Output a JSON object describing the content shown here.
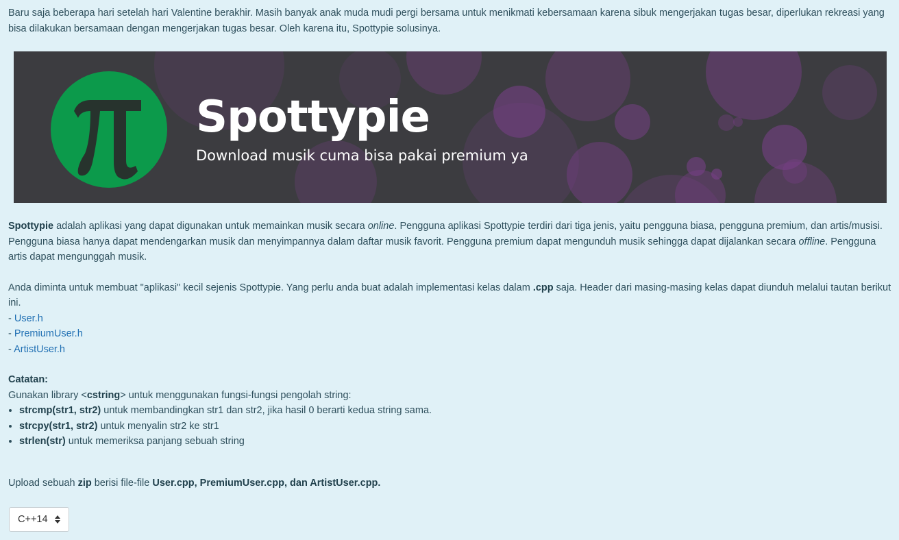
{
  "intro": "Baru saja beberapa hari setelah hari Valentine berakhir. Masih banyak anak muda mudi pergi bersama untuk menikmati kebersamaan karena sibuk mengerjakan tugas besar, diperlukan rekreasi yang bisa dilakukan bersamaan dengan mengerjakan tugas besar. Oleh karena itu, Spottypie solusinya.",
  "banner": {
    "logo_glyph": "π",
    "title": "Spottypie",
    "subtitle": "Download musik cuma bisa pakai premium ya",
    "colors": {
      "background": "#3c3c40",
      "logo": "#0c9a4b",
      "bubble": "#7a3f8a"
    }
  },
  "description": {
    "app_name": "Spottypie",
    "part1": " adalah aplikasi yang dapat digunakan untuk memainkan musik secara ",
    "online": "online",
    "part2": ". Pengguna aplikasi Spottypie terdiri dari tiga jenis, yaitu pengguna biasa, pengguna premium, dan artis/musisi. Pengguna biasa hanya dapat mendengarkan musik dan menyimpannya dalam daftar musik favorit. Pengguna premium dapat mengunduh musik sehingga dapat dijalankan secara ",
    "offline": "offline",
    "part3": ". Pengguna artis dapat mengunggah musik."
  },
  "task": {
    "part1": "Anda diminta untuk membuat \"aplikasi\" kecil sejenis Spottypie. Yang perlu anda buat adalah implementasi kelas dalam ",
    "ext": ".cpp",
    "part2": " saja. Header dari masing-masing kelas dapat diunduh melalui tautan berikut ini.",
    "link_prefix": "- ",
    "links": [
      "User.h",
      "PremiumUser.h",
      "ArtistUser.h"
    ]
  },
  "note": {
    "heading": "Catatan:",
    "part1": "Gunakan library <",
    "lib": "cstring",
    "part2": "> untuk menggunakan fungsi-fungsi pengolah string:",
    "items": [
      {
        "fn": "strcmp(str1, str2)",
        "desc": " untuk membandingkan str1 dan str2, jika hasil 0 berarti kedua string sama."
      },
      {
        "fn": "strcpy(str1, str2)",
        "desc": " untuk menyalin str2 ke str1"
      },
      {
        "fn": "strlen(str)",
        "desc": " untuk memeriksa panjang sebuah string"
      }
    ]
  },
  "upload": {
    "part1": "Upload sebuah ",
    "zip": "zip",
    "part2": " berisi file-file ",
    "files": "User.cpp, PremiumUser.cpp, dan ArtistUser.cpp."
  },
  "language_select": {
    "value": "C++14",
    "icon": "sort-arrows-icon"
  }
}
